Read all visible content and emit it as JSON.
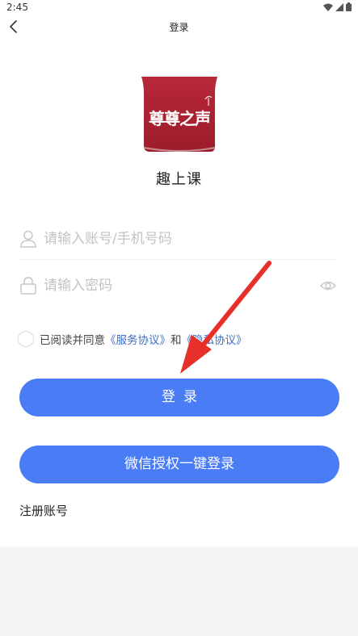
{
  "status_bar": {
    "time": "2:45"
  },
  "nav": {
    "title": "登录"
  },
  "logo": {
    "text": "尊尊之声"
  },
  "app": {
    "name": "趣上课"
  },
  "form": {
    "account_placeholder": "请输入账号/手机号码",
    "account_value": "",
    "password_placeholder": "请输入密码",
    "password_value": ""
  },
  "agreement": {
    "prefix": "已阅读并同意",
    "service_link": "《服务协议》",
    "conjunction": "和",
    "privacy_link": "《隐私协议》",
    "checked": false
  },
  "buttons": {
    "login": "登录",
    "wechat_login": "微信授权一键登录"
  },
  "links": {
    "register": "注册账号"
  },
  "colors": {
    "primary": "#4a7cf6",
    "link": "#3b6fc9",
    "logo_red": "#a8202e",
    "annotation_arrow": "#e8302b"
  },
  "icons": {
    "back": "chevron-left-icon",
    "account": "user-icon",
    "password": "lock-icon",
    "visibility": "eye-icon",
    "wifi": "wifi-icon",
    "signal": "signal-icon",
    "battery": "battery-icon"
  }
}
